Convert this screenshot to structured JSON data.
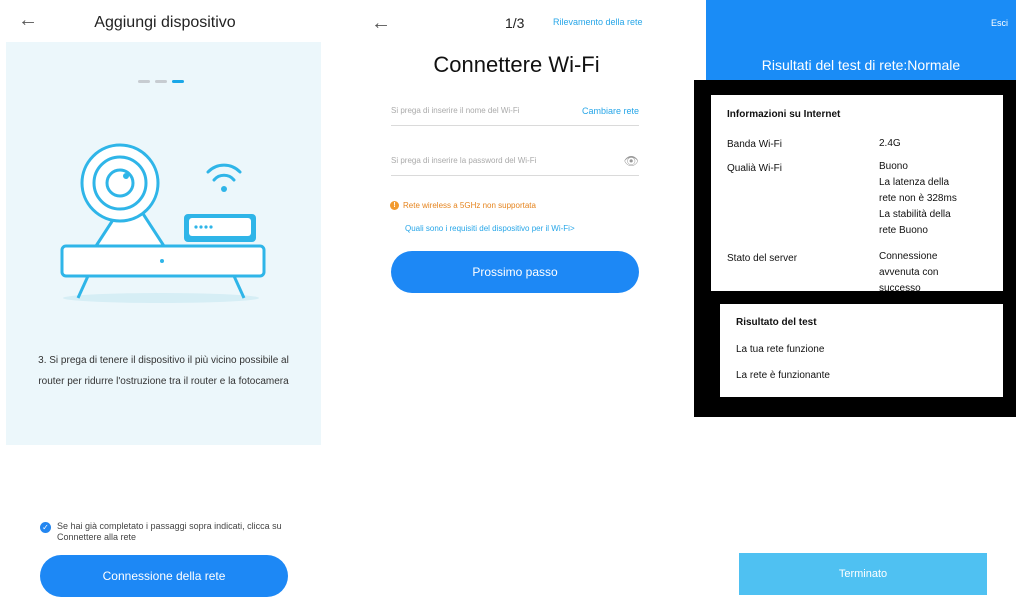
{
  "colors": {
    "primary_button": "#1d88f5",
    "link": "#27a6e8",
    "header_blue": "#1a8cf6",
    "warning": "#e5841e",
    "done_button": "#4fc1f2",
    "illustration_bg": "#ecf7fb"
  },
  "panel1": {
    "back_icon": "←",
    "title": "Aggiungi dispositivo",
    "instruction": "3. Si prega di tenere il dispositivo il più vicino possibile al router per ridurre l'ostruzione tra il router e la fotocamera",
    "confirm_text": "Se hai già completato i passaggi sopra indicati, clicca su Connettere alla rete",
    "connect_button": "Connessione della rete"
  },
  "panel2": {
    "back_icon": "←",
    "step": "1/3",
    "network_detect": "Rilevamento della rete",
    "title": "Connettere Wi-Fi",
    "wifi_name_placeholder": "Si prega di inserire il nome del Wi-Fi",
    "change_network": "Cambiare rete",
    "password_placeholder": "Si prega di inserire la password del Wi-Fi",
    "warning": "Rete wireless a 5GHz non supportata",
    "requirements_link": "Quali sono i requisiti del dispositivo per il Wi-Fi>",
    "next_button": "Prossimo passo"
  },
  "panel3": {
    "exit": "Esci",
    "title": "Risultati del test di rete:Normale",
    "info_section": "Informazioni su Internet",
    "band_label": "Banda Wi-Fi",
    "band_value": "2.4G",
    "quality_label": "Qualià Wi-Fi",
    "quality_value_1": "Buono",
    "quality_value_2": "La latenza della",
    "quality_value_3": "rete non è 328ms",
    "quality_value_4": "La stabilità della",
    "quality_value_5": "rete Buono",
    "server_label": "Stato del server",
    "server_value_1": "Connessione",
    "server_value_2": "avvenuta con",
    "server_value_3": "successo",
    "result_section": "Risultato del test",
    "result_1": "La tua rete funzione",
    "result_2": "La rete è funzionante",
    "done_button": "Terminato"
  }
}
